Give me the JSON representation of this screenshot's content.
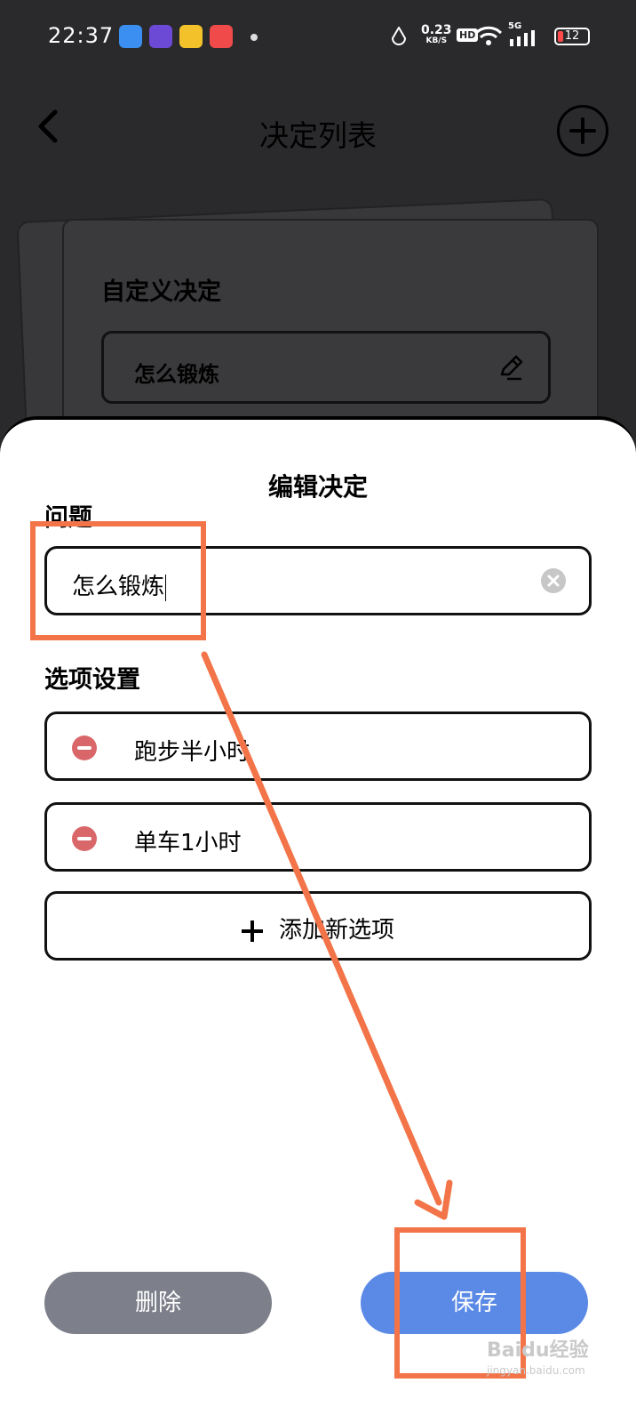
{
  "status_bar": {
    "time": "22:37",
    "net_speed": "0.23",
    "net_unit": "KB/S",
    "hd": "HD",
    "signal": "5G",
    "battery": "12",
    "app_icons": [
      "app-blue-icon",
      "app-purple-icon",
      "app-yellow-icon",
      "app-red-music-icon"
    ]
  },
  "header": {
    "title": "决定列表"
  },
  "background_card": {
    "title": "自定义决定",
    "item_label": "怎么锻炼"
  },
  "sheet": {
    "title": "编辑决定",
    "question_label": "问题",
    "question_value": "怎么锻炼",
    "options_label": "选项设置",
    "options": [
      "跑步半小时",
      "单车1小时"
    ],
    "add_option_label": "添加新选项",
    "delete_label": "删除",
    "save_label": "保存"
  },
  "colors": {
    "delete_button": "#7d7f8a",
    "save_button": "#5b8ae6",
    "remove_icon": "#d9676a",
    "annotation": "#f27448"
  },
  "watermark": {
    "text": "Baidu经验",
    "sub": "jingyan.baidu.com"
  }
}
